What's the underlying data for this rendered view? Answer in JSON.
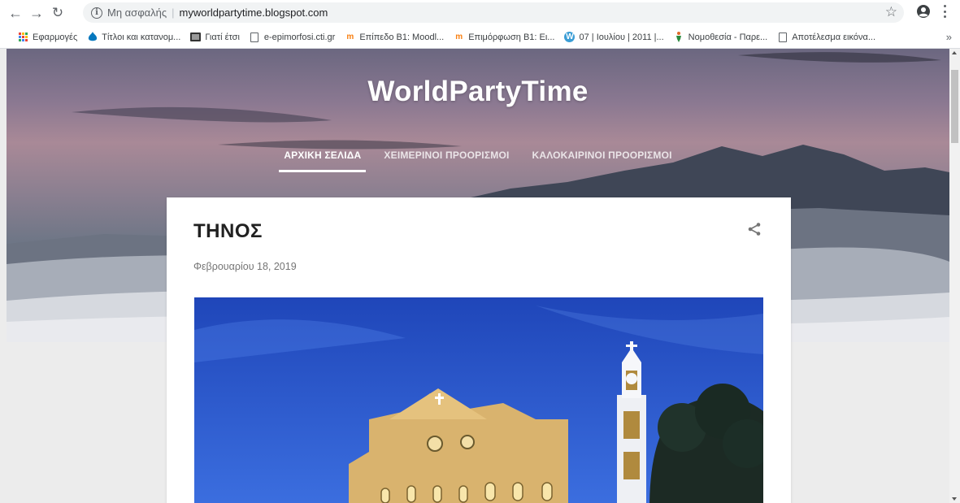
{
  "browser": {
    "security_label": "Μη ασφαλής",
    "separator": "|",
    "url": "myworldpartytime.blogspot.com",
    "bookmarks": [
      {
        "label": "Εφαρμογές",
        "icon": "apps-icon"
      },
      {
        "label": "Τίτλοι και κατανομ...",
        "icon": "drupal-icon"
      },
      {
        "label": "Γιατί έτσι",
        "icon": "film-icon"
      },
      {
        "label": "e-epimorfosi.cti.gr",
        "icon": "page-icon"
      },
      {
        "label": "Επίπεδο Β1: Moodl...",
        "icon": "moodle-icon"
      },
      {
        "label": "Επιμόρφωση Β1: Ει...",
        "icon": "moodle-icon"
      },
      {
        "label": "07 | Ιουλίου | 2011 |...",
        "icon": "wordpress-icon"
      },
      {
        "label": "Νομοθεσία - Παρε...",
        "icon": "figure-icon"
      },
      {
        "label": "Αποτέλεσμα εικόνα...",
        "icon": "page-icon"
      }
    ],
    "more_glyph": "»"
  },
  "blog": {
    "title": "WorldPartyTime",
    "tabs": [
      {
        "label": "ΑΡΧΙΚΗ ΣΕΛΙΔΑ",
        "active": true
      },
      {
        "label": "ΧΕΙΜΕΡΙΝΟΙ ΠΡΟΟΡΙΣΜΟΙ",
        "active": false
      },
      {
        "label": "ΚΑΛΟΚΑΙΡΙΝΟΙ ΠΡΟΟΡΙΣΜΟΙ",
        "active": false
      }
    ]
  },
  "post": {
    "title": "ΤΗΝΟΣ",
    "date": "Φεβρουαρίου 18, 2019",
    "image_subject": "church-at-night-icon"
  },
  "colors": {
    "sky_top": "#6b6780",
    "night_sky": "#2c56c7",
    "building": "#d9b36e",
    "accent_white": "#ffffff"
  }
}
